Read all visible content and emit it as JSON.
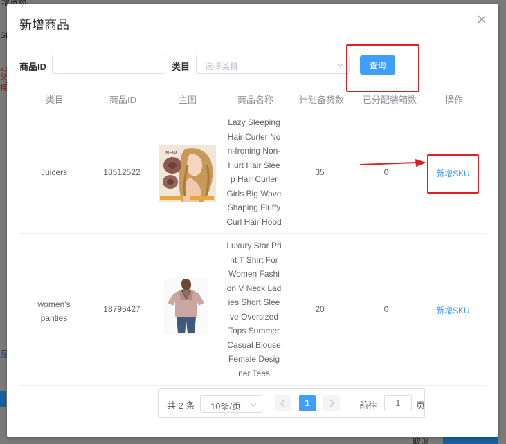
{
  "background": {
    "fragments": [
      "增货物",
      "SKU",
      "分",
      "的",
      "接",
      "品",
      "添"
    ],
    "bottom_buttons": [
      "取消"
    ]
  },
  "dialog": {
    "title": "新增商品",
    "close_icon": "close-icon"
  },
  "filters": {
    "product_id_label": "商品ID",
    "product_id_value": "",
    "category_label": "类目",
    "category_placeholder": "选择类目",
    "query_label": "查询"
  },
  "table": {
    "columns": [
      "类目",
      "商品ID",
      "主图",
      "商品名称",
      "计划备货数",
      "已分配装箱数",
      "操作"
    ],
    "rows": [
      {
        "category": "Juicers",
        "product_id": "18512522",
        "image": "hair-curler-product-image",
        "name": "Lazy Sleeping Hair Curler Non-Ironing Non-Hurt Hair Sleep Hair Curler Girls Big Wave Shaping Fluffy Curl Hair Hood",
        "planned": "35",
        "allocated": "0",
        "action": "新增SKU"
      },
      {
        "category": "women's panties",
        "product_id": "18795427",
        "image": "tshirt-product-image",
        "name": "Luxury Star Print T Shirt For Women Fashion V Neck Ladies Short Sleeve Oversized Tops Summer Casual Blouse Female Designer Tees",
        "planned": "20",
        "allocated": "0",
        "action": "新增SKU"
      }
    ]
  },
  "pagination": {
    "total": "共 2 条",
    "page_size": "10条/页",
    "current_page": "1",
    "goto_prefix": "前往",
    "goto_value": "1",
    "goto_suffix": "页"
  },
  "colors": {
    "primary": "#409eff",
    "annotation_red": "#e02020"
  }
}
